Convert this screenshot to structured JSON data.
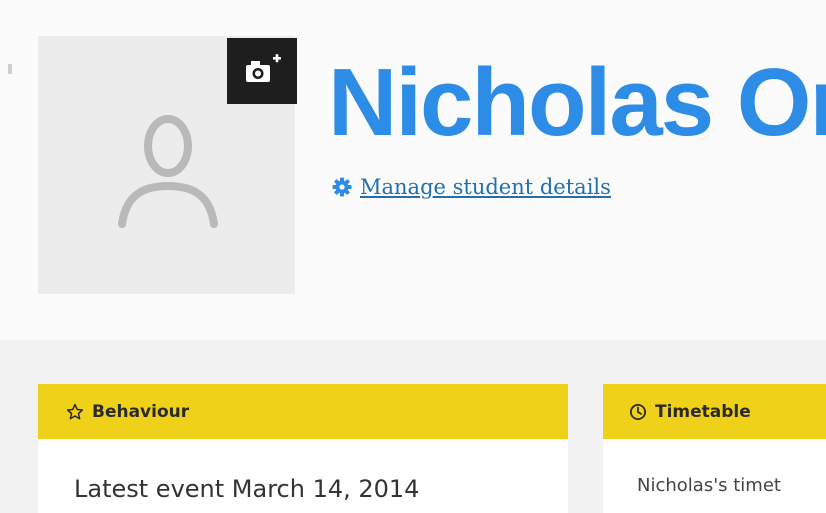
{
  "profile": {
    "name": "Nicholas Or",
    "manage_link": "Manage student details",
    "avatar_icon": "user-placeholder-icon",
    "photo_button_icon": "camera-add-icon",
    "manage_icon": "gear-icon"
  },
  "cards": {
    "behaviour": {
      "title": "Behaviour",
      "icon": "star-outline-icon",
      "latest_event": "Latest event March 14, 2014"
    },
    "timetable": {
      "title": "Timetable",
      "icon": "clock-icon",
      "text": "Nicholas's timet"
    }
  },
  "colors": {
    "accent_blue": "#2d8de6",
    "link_blue": "#1f6fb2",
    "card_header_yellow": "#f0d11a",
    "photo_button_dark": "#1e1e1e"
  }
}
